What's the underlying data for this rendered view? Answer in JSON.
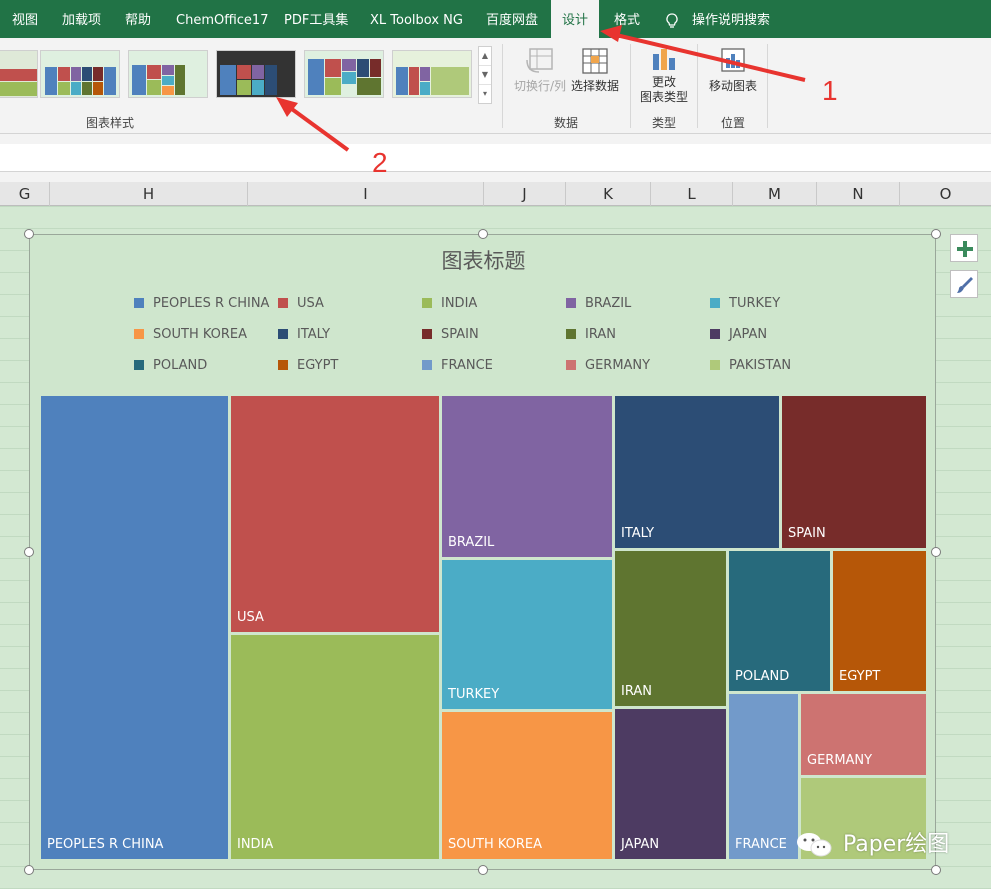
{
  "ribbon_tabs": [
    "视图",
    "加载项",
    "帮助",
    "ChemOffice17",
    "PDF工具集",
    "XL Toolbox NG",
    "百度网盘",
    "设计",
    "格式",
    "操作说明搜索"
  ],
  "active_tab": "设计",
  "ribbon": {
    "chart_styles_label": "图表样式",
    "data_group_label": "数据",
    "type_group_label": "类型",
    "position_group_label": "位置",
    "switch_row_col": "切换行/列",
    "select_data": "选择数据",
    "change_type_line1": "更改",
    "change_type_line2": "图表类型",
    "move_chart": "移动图表"
  },
  "columns": [
    "G",
    "H",
    "I",
    "J",
    "K",
    "L",
    "M",
    "N",
    "O"
  ],
  "chart": {
    "title": "图表标题",
    "legend": [
      {
        "name": "PEOPLES R CHINA",
        "color": "#4f81bd"
      },
      {
        "name": "USA",
        "color": "#c0504d"
      },
      {
        "name": "INDIA",
        "color": "#9bbb59"
      },
      {
        "name": "BRAZIL",
        "color": "#8064a2"
      },
      {
        "name": "TURKEY",
        "color": "#4bacc6"
      },
      {
        "name": "SOUTH KOREA",
        "color": "#f79646"
      },
      {
        "name": "ITALY",
        "color": "#2c4d75"
      },
      {
        "name": "SPAIN",
        "color": "#772c2a"
      },
      {
        "name": "IRAN",
        "color": "#5f7530"
      },
      {
        "name": "JAPAN",
        "color": "#4d3b62"
      },
      {
        "name": "POLAND",
        "color": "#276a7c"
      },
      {
        "name": "EGYPT",
        "color": "#b65708"
      },
      {
        "name": "FRANCE",
        "color": "#729aca"
      },
      {
        "name": "GERMANY",
        "color": "#cd7371"
      },
      {
        "name": "PAKISTAN",
        "color": "#afc97a"
      }
    ]
  },
  "watermark": "Paper绘图",
  "annotations": [
    "1",
    "2"
  ]
}
